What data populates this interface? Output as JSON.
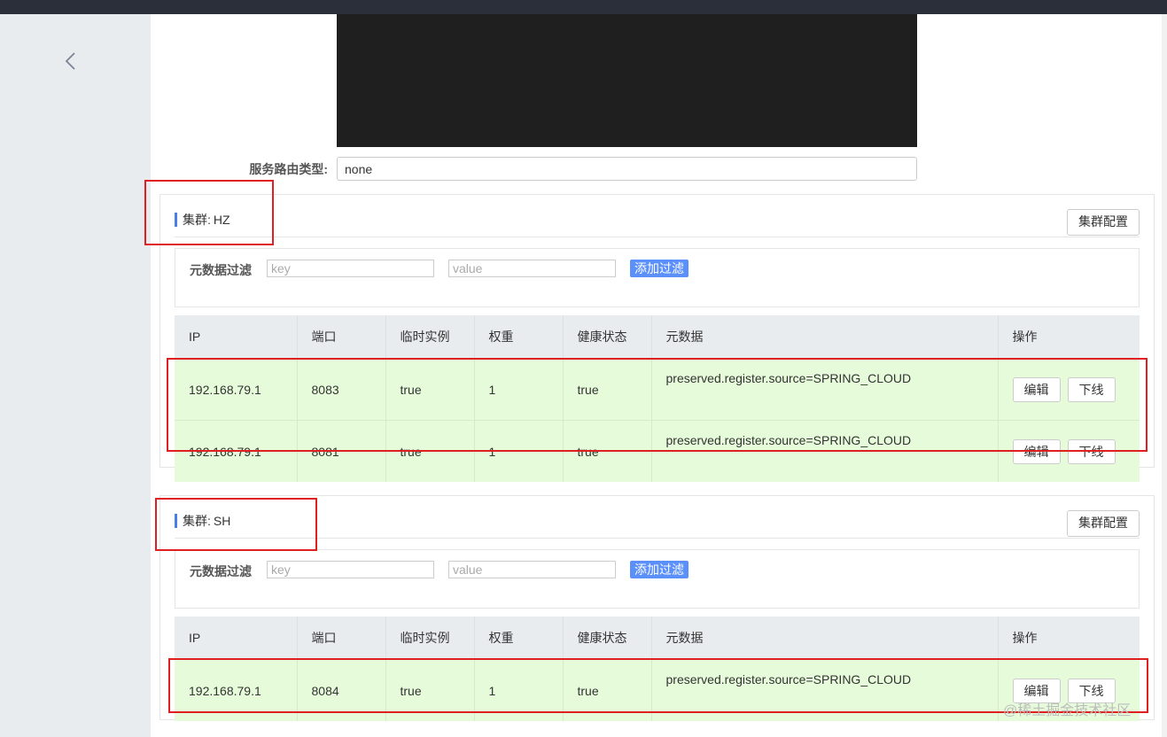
{
  "route": {
    "label": "服务路由类型:",
    "value": "none"
  },
  "filter": {
    "label": "元数据过滤",
    "key_placeholder": "key",
    "value_placeholder": "value",
    "add_label": "添加过滤"
  },
  "table_headers": [
    "IP",
    "端口",
    "临时实例",
    "权重",
    "健康状态",
    "元数据",
    "操作"
  ],
  "actions": {
    "edit": "编辑",
    "offline": "下线"
  },
  "cluster_prefix": "集群:",
  "config_label": "集群配置",
  "clusters": [
    {
      "name": "HZ",
      "instances": [
        {
          "ip": "192.168.79.1",
          "port": "8083",
          "ephemeral": "true",
          "weight": "1",
          "healthy": "true",
          "metadata": "preserved.register.source=SPRING_CLOUD"
        },
        {
          "ip": "192.168.79.1",
          "port": "8081",
          "ephemeral": "true",
          "weight": "1",
          "healthy": "true",
          "metadata": "preserved.register.source=SPRING_CLOUD"
        }
      ]
    },
    {
      "name": "SH",
      "instances": [
        {
          "ip": "192.168.79.1",
          "port": "8084",
          "ephemeral": "true",
          "weight": "1",
          "healthy": "true",
          "metadata": "preserved.register.source=SPRING_CLOUD"
        }
      ]
    }
  ],
  "watermark": "@稀土掘金技术社区",
  "colors": {
    "accent": "#5b8ff9",
    "row_bg": "#e6fbd9",
    "highlight": "#e02020",
    "header_bg": "#e9ecef"
  }
}
